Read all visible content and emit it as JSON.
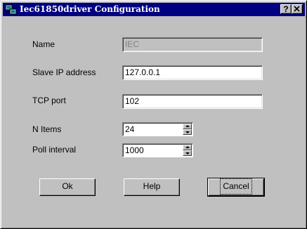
{
  "window": {
    "title": "Iec61850driver Configuration",
    "help_button": "?",
    "close_button": "X",
    "icon": "network-driver-icon"
  },
  "form": {
    "name": {
      "label": "Name",
      "value": "IEC",
      "disabled": true
    },
    "slave_ip": {
      "label": "Slave IP address",
      "value": "127.0.0.1"
    },
    "tcp_port": {
      "label": "TCP port",
      "value": "102"
    },
    "n_items": {
      "label": "N Items",
      "value": "24"
    },
    "poll_interval": {
      "label": "Poll interval",
      "value": "1000"
    }
  },
  "buttons": {
    "ok": "Ok",
    "help": "Help",
    "cancel": "Cancel"
  },
  "colors": {
    "titlebar": "#000080",
    "face": "#c0c0c0"
  }
}
